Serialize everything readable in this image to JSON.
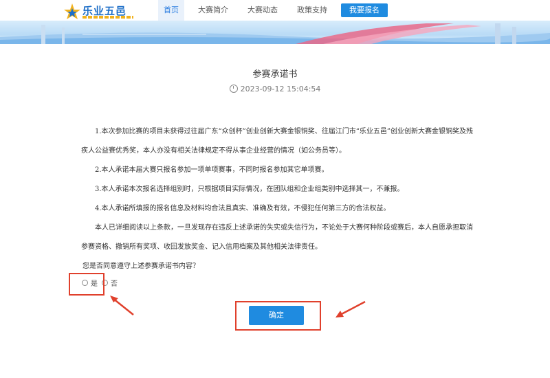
{
  "header": {
    "brand": "乐业五邑",
    "nav": [
      {
        "label": "首页",
        "active": true
      },
      {
        "label": "大赛简介",
        "active": false
      },
      {
        "label": "大赛动态",
        "active": false
      },
      {
        "label": "政策支持",
        "active": false
      }
    ],
    "signup_label": "我要报名"
  },
  "document": {
    "title": "参赛承诺书",
    "date": "2023-09-12 15:04:54",
    "paragraphs": [
      "1.本次参加比赛的项目未获得过往届广东“众创杯”创业创新大赛金银铜奖、往届江门市“乐业五邑”创业创新大赛金银铜奖及残疾人公益赛优秀奖，本人亦没有相关法律规定不得从事企业经营的情况（如公务员等）。",
      "2.本人承诺本届大赛只报名参加一项单项赛事，不同时报名参加其它单项赛。",
      "3.本人承诺本次报名选择组别时，只根据项目实际情况，在团队组和企业组类别中选择其一，不兼报。",
      "4.本人承诺所填报的报名信息及材料均合法且真实、准确及有效，不侵犯任何第三方的合法权益。",
      "本人已详细阅读以上条款，一旦发现存在违反上述承诺的失实或失信行为，不论处于大赛何种阶段或赛后，本人自愿承担取消参赛资格、撤销所有奖项、收回发放奖金、记入信用档案及其他相关法律责任。"
    ],
    "question": "您是否同意遵守上述参赛承诺书内容？",
    "options": {
      "yes": "是",
      "no": "否"
    },
    "confirm_label": "确定"
  },
  "colors": {
    "accent": "#1f8be0",
    "highlight": "#e0402c"
  }
}
